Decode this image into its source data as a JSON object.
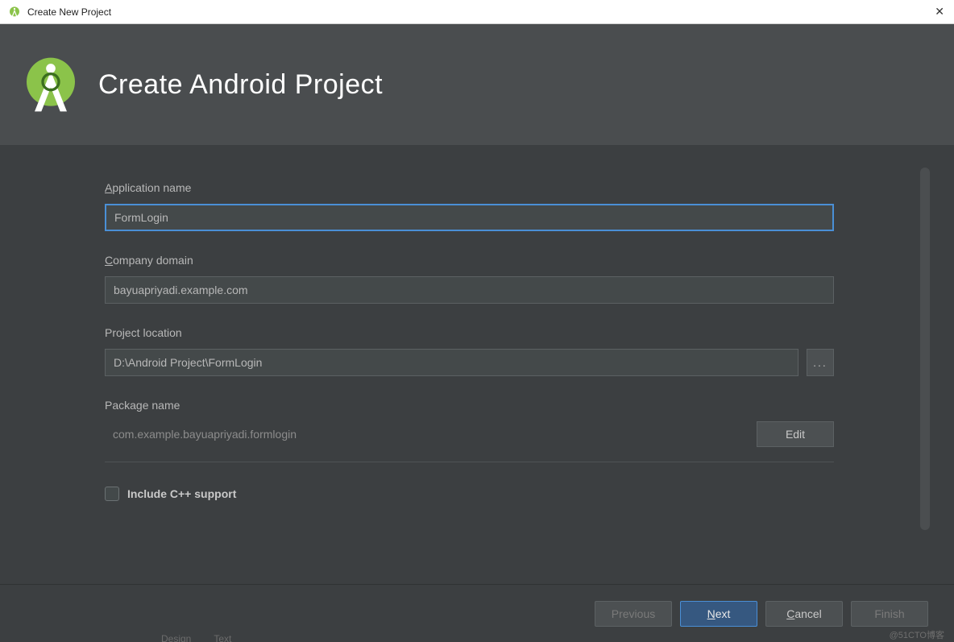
{
  "window": {
    "title": "Create New Project"
  },
  "header": {
    "title": "Create Android Project"
  },
  "form": {
    "app_name_label_pre": "A",
    "app_name_label_rest": "pplication name",
    "app_name_value": "FormLogin",
    "company_domain_label_pre": "C",
    "company_domain_label_rest": "ompany domain",
    "company_domain_value": "bayuapriyadi.example.com",
    "project_location_label": "Project location",
    "project_location_value": "D:\\Android Project\\FormLogin",
    "browse_label": "...",
    "package_name_label": "Package name",
    "package_name_value": "com.example.bayuapriyadi.formlogin",
    "edit_label": "Edit",
    "cpp_label": "Include C++ support",
    "cpp_checked": false
  },
  "footer": {
    "previous": "Previous",
    "next_pre": "N",
    "next_rest": "ext",
    "cancel_pre": "C",
    "cancel_rest": "ancel",
    "finish": "Finish"
  },
  "watermark": "@51CTO博客",
  "hidden_tabs": {
    "design": "Design",
    "text": "Text"
  }
}
